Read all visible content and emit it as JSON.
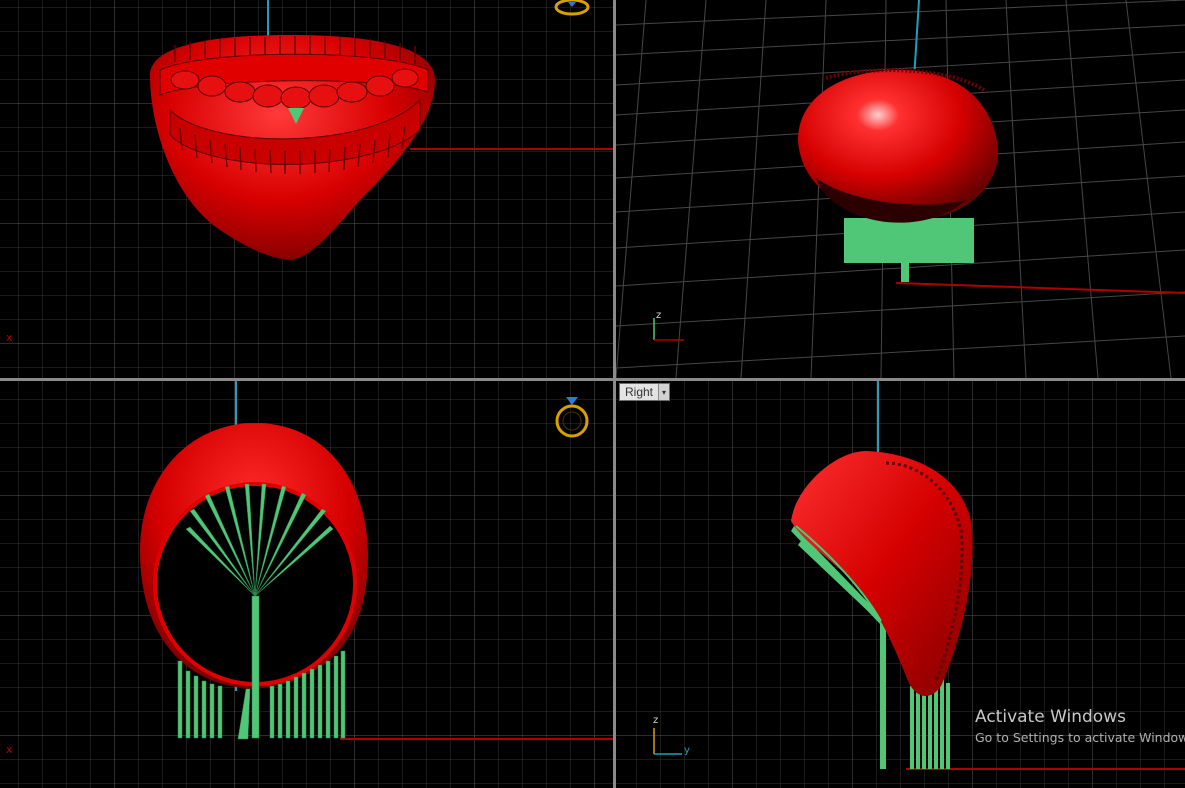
{
  "viewports": {
    "top": {
      "axis_label": "x"
    },
    "perspective": {
      "axis_label_z": "z"
    },
    "front": {
      "axis_label": "x"
    },
    "right": {
      "title": "Right",
      "dropdown_glyph": "▾",
      "axis_label_z": "z",
      "axis_label_y": "y"
    }
  },
  "icons": {
    "ring_gumball": "ring-diamond-icon",
    "dropdown": "chevron-down-icon"
  },
  "colors": {
    "background": "#000000",
    "grid": "#3c3c3c",
    "grid_major": "#5a5a5a",
    "axis_x": "#b00000",
    "axis_y": "#1fa0b8",
    "model_red": "#d40000",
    "support_green": "#4fc777",
    "gumball": "#d8a000"
  },
  "watermark": {
    "title": "Activate Windows",
    "subtitle": "Go to Settings to activate Windows."
  }
}
